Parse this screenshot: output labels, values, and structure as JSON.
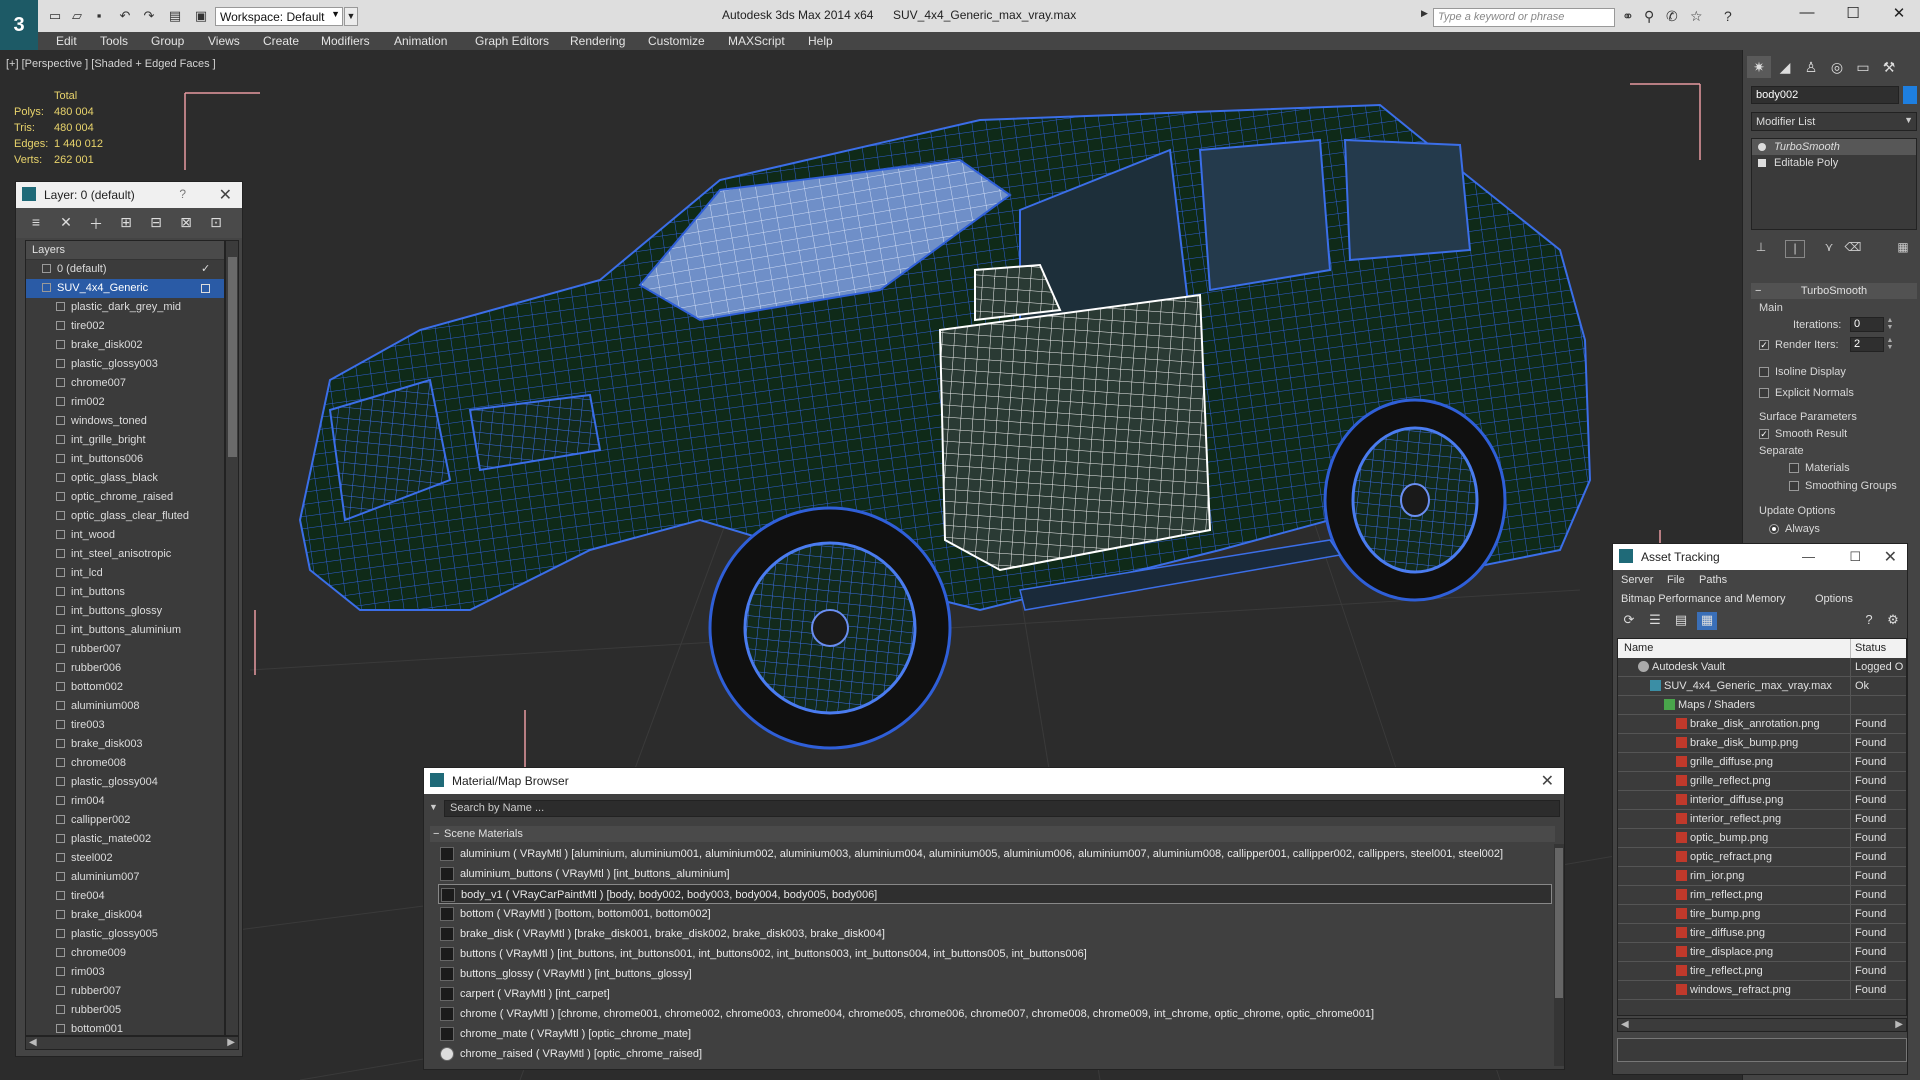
{
  "titlebar": {
    "app_title": "Autodesk 3ds Max  2014 x64",
    "file_name": "SUV_4x4_Generic_max_vray.max",
    "workspace": "Workspace: Default",
    "search_placeholder": "Type a keyword or phrase"
  },
  "menu": [
    "Edit",
    "Tools",
    "Group",
    "Views",
    "Create",
    "Modifiers",
    "Animation",
    "Graph Editors",
    "Rendering",
    "Customize",
    "MAXScript",
    "Help"
  ],
  "viewport": {
    "label": "[+] [Perspective ] [Shaded + Edged Faces ]",
    "stats_header": "Total",
    "stats": [
      {
        "label": "Polys:",
        "value": "480 004"
      },
      {
        "label": "Tris:",
        "value": "480 004"
      },
      {
        "label": "Edges:",
        "value": "1 440 012"
      },
      {
        "label": "Verts:",
        "value": "262 001"
      }
    ]
  },
  "layer_panel": {
    "title": "Layer: 0 (default)",
    "help": "?",
    "header": "Layers",
    "layers": [
      {
        "name": "0 (default)",
        "level": 1,
        "check": "✓"
      },
      {
        "name": "SUV_4x4_Generic",
        "level": 1,
        "selected": true
      },
      {
        "name": "plastic_dark_grey_mid",
        "level": 2
      },
      {
        "name": "tire002",
        "level": 2
      },
      {
        "name": "brake_disk002",
        "level": 2
      },
      {
        "name": "plastic_glossy003",
        "level": 2
      },
      {
        "name": "chrome007",
        "level": 2
      },
      {
        "name": "rim002",
        "level": 2
      },
      {
        "name": "windows_toned",
        "level": 2
      },
      {
        "name": "int_grille_bright",
        "level": 2
      },
      {
        "name": "int_buttons006",
        "level": 2
      },
      {
        "name": "optic_glass_black",
        "level": 2
      },
      {
        "name": "optic_chrome_raised",
        "level": 2
      },
      {
        "name": "optic_glass_clear_fluted",
        "level": 2
      },
      {
        "name": "int_wood",
        "level": 2
      },
      {
        "name": "int_steel_anisotropic",
        "level": 2
      },
      {
        "name": "int_lcd",
        "level": 2
      },
      {
        "name": "int_buttons",
        "level": 2
      },
      {
        "name": "int_buttons_glossy",
        "level": 2
      },
      {
        "name": "int_buttons_aluminium",
        "level": 2
      },
      {
        "name": "rubber007",
        "level": 2
      },
      {
        "name": "rubber006",
        "level": 2
      },
      {
        "name": "bottom002",
        "level": 2
      },
      {
        "name": "aluminium008",
        "level": 2
      },
      {
        "name": "tire003",
        "level": 2
      },
      {
        "name": "brake_disk003",
        "level": 2
      },
      {
        "name": "chrome008",
        "level": 2
      },
      {
        "name": "plastic_glossy004",
        "level": 2
      },
      {
        "name": "rim004",
        "level": 2
      },
      {
        "name": "callipper002",
        "level": 2
      },
      {
        "name": "plastic_mate002",
        "level": 2
      },
      {
        "name": "steel002",
        "level": 2
      },
      {
        "name": "aluminium007",
        "level": 2
      },
      {
        "name": "tire004",
        "level": 2
      },
      {
        "name": "brake_disk004",
        "level": 2
      },
      {
        "name": "plastic_glossy005",
        "level": 2
      },
      {
        "name": "chrome009",
        "level": 2
      },
      {
        "name": "rim003",
        "level": 2
      },
      {
        "name": "rubber007",
        "level": 2
      },
      {
        "name": "rubber005",
        "level": 2
      },
      {
        "name": "bottom001",
        "level": 2
      }
    ]
  },
  "command_panel": {
    "object_name": "body002",
    "object_color": "#1e7fe0",
    "modifier_list": "Modifier List",
    "stack": [
      "TurboSmooth",
      "Editable Poly"
    ],
    "rollout_title": "TurboSmooth",
    "main_group": "Main",
    "iterations_label": "Iterations:",
    "iterations_value": "0",
    "render_iters_label": "Render Iters:",
    "render_iters_value": "2",
    "render_iters_checked": "✓",
    "isoline_label": "Isoline Display",
    "explicit_normals_label": "Explicit Normals",
    "surface_group": "Surface Parameters",
    "smooth_result_label": "Smooth Result",
    "smooth_result_checked": "✓",
    "separate_label": "Separate",
    "materials_label": "Materials",
    "smoothing_groups_label": "Smoothing Groups",
    "update_group": "Update Options",
    "always_label": "Always"
  },
  "asset_tracking": {
    "title": "Asset Tracking",
    "menu_row1": [
      "Server",
      "File",
      "Paths"
    ],
    "menu_row2": [
      "Bitmap Performance and Memory",
      "Options"
    ],
    "col_name": "Name",
    "col_status": "Status",
    "rows": [
      {
        "name": "Autodesk Vault",
        "status": "Logged O",
        "indent": 20,
        "icon": "vault"
      },
      {
        "name": "SUV_4x4_Generic_max_vray.max",
        "status": "Ok",
        "indent": 32,
        "icon": "max"
      },
      {
        "name": "Maps / Shaders",
        "status": "",
        "indent": 46,
        "icon": "maps"
      },
      {
        "name": "brake_disk_anrotation.png",
        "status": "Found",
        "indent": 58,
        "icon": "png"
      },
      {
        "name": "brake_disk_bump.png",
        "status": "Found",
        "indent": 58,
        "icon": "png"
      },
      {
        "name": "grille_diffuse.png",
        "status": "Found",
        "indent": 58,
        "icon": "png"
      },
      {
        "name": "grille_reflect.png",
        "status": "Found",
        "indent": 58,
        "icon": "png"
      },
      {
        "name": "interior_diffuse.png",
        "status": "Found",
        "indent": 58,
        "icon": "png"
      },
      {
        "name": "interior_reflect.png",
        "status": "Found",
        "indent": 58,
        "icon": "png"
      },
      {
        "name": "optic_bump.png",
        "status": "Found",
        "indent": 58,
        "icon": "png"
      },
      {
        "name": "optic_refract.png",
        "status": "Found",
        "indent": 58,
        "icon": "png"
      },
      {
        "name": "rim_ior.png",
        "status": "Found",
        "indent": 58,
        "icon": "png"
      },
      {
        "name": "rim_reflect.png",
        "status": "Found",
        "indent": 58,
        "icon": "png"
      },
      {
        "name": "tire_bump.png",
        "status": "Found",
        "indent": 58,
        "icon": "png"
      },
      {
        "name": "tire_diffuse.png",
        "status": "Found",
        "indent": 58,
        "icon": "png"
      },
      {
        "name": "tire_displace.png",
        "status": "Found",
        "indent": 58,
        "icon": "png"
      },
      {
        "name": "tire_reflect.png",
        "status": "Found",
        "indent": 58,
        "icon": "png"
      },
      {
        "name": "windows_refract.png",
        "status": "Found",
        "indent": 58,
        "icon": "png"
      }
    ]
  },
  "material_browser": {
    "title": "Material/Map Browser",
    "search_placeholder": "Search by Name ...",
    "group": "Scene Materials",
    "materials": [
      {
        "text": "aluminium  ( VRayMtl )  [aluminium, aluminium001, aluminium002, aluminium003, aluminium004, aluminium005, aluminium006, aluminium007, aluminium008, callipper001, callipper002, callippers, steel001, steel002]"
      },
      {
        "text": "aluminium_buttons  ( VRayMtl )  [int_buttons_aluminium]"
      },
      {
        "text": "body_v1  ( VRayCarPaintMtl )  [body, body002, body003, body004, body005, body006]",
        "selected": true
      },
      {
        "text": "bottom  ( VRayMtl )  [bottom, bottom001, bottom002]"
      },
      {
        "text": "brake_disk  ( VRayMtl )  [brake_disk001, brake_disk002, brake_disk003, brake_disk004]"
      },
      {
        "text": "buttons  ( VRayMtl )  [int_buttons, int_buttons001, int_buttons002, int_buttons003, int_buttons004, int_buttons005, int_buttons006]"
      },
      {
        "text": "buttons_glossy  ( VRayMtl )  [int_buttons_glossy]"
      },
      {
        "text": "carpert  ( VRayMtl )  [int_carpet]"
      },
      {
        "text": "chrome  ( VRayMtl )  [chrome, chrome001, chrome002, chrome003, chrome004, chrome005, chrome006, chrome007, chrome008, chrome009, int_chrome, optic_chrome, optic_chrome001]"
      },
      {
        "text": "chrome_mate  ( VRayMtl )  [optic_chrome_mate]"
      },
      {
        "text": "chrome_raised  ( VRayMtl )  [optic_chrome_raised]",
        "swatch": "white"
      }
    ]
  }
}
